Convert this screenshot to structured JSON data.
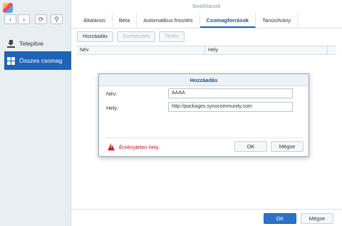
{
  "window": {
    "title": "Beállítások"
  },
  "sidebar": {
    "nav": {
      "back_icon": "‹",
      "forward_icon": "›",
      "refresh_icon": "⟳",
      "search_icon": "⚲"
    },
    "items": [
      {
        "label": "Telepítve"
      },
      {
        "label": "Összes csomag"
      }
    ]
  },
  "tabs": [
    "Általános",
    "Béta",
    "Automatikus frissítés",
    "Csomagforrások",
    "Tanúsítvány"
  ],
  "active_tab": "Csomagforrások",
  "toolbar": {
    "add": "Hozzáadás",
    "edit": "Szerkesztés",
    "delete": "Törlés"
  },
  "table": {
    "columns": [
      "Név",
      "Hely"
    ]
  },
  "footer": {
    "ok": "OK",
    "cancel": "Mégse"
  },
  "dialog": {
    "title": "Hozzáadás",
    "name_label": "Név:",
    "name_value": "AAAA",
    "location_label": "Hely:",
    "location_value": "http://packages.synocommunity.com",
    "error": "Érvénytelen hely.",
    "ok": "OK",
    "cancel": "Mégse"
  },
  "colors": {
    "accent": "#1e63b6",
    "error": "#c8102e"
  }
}
